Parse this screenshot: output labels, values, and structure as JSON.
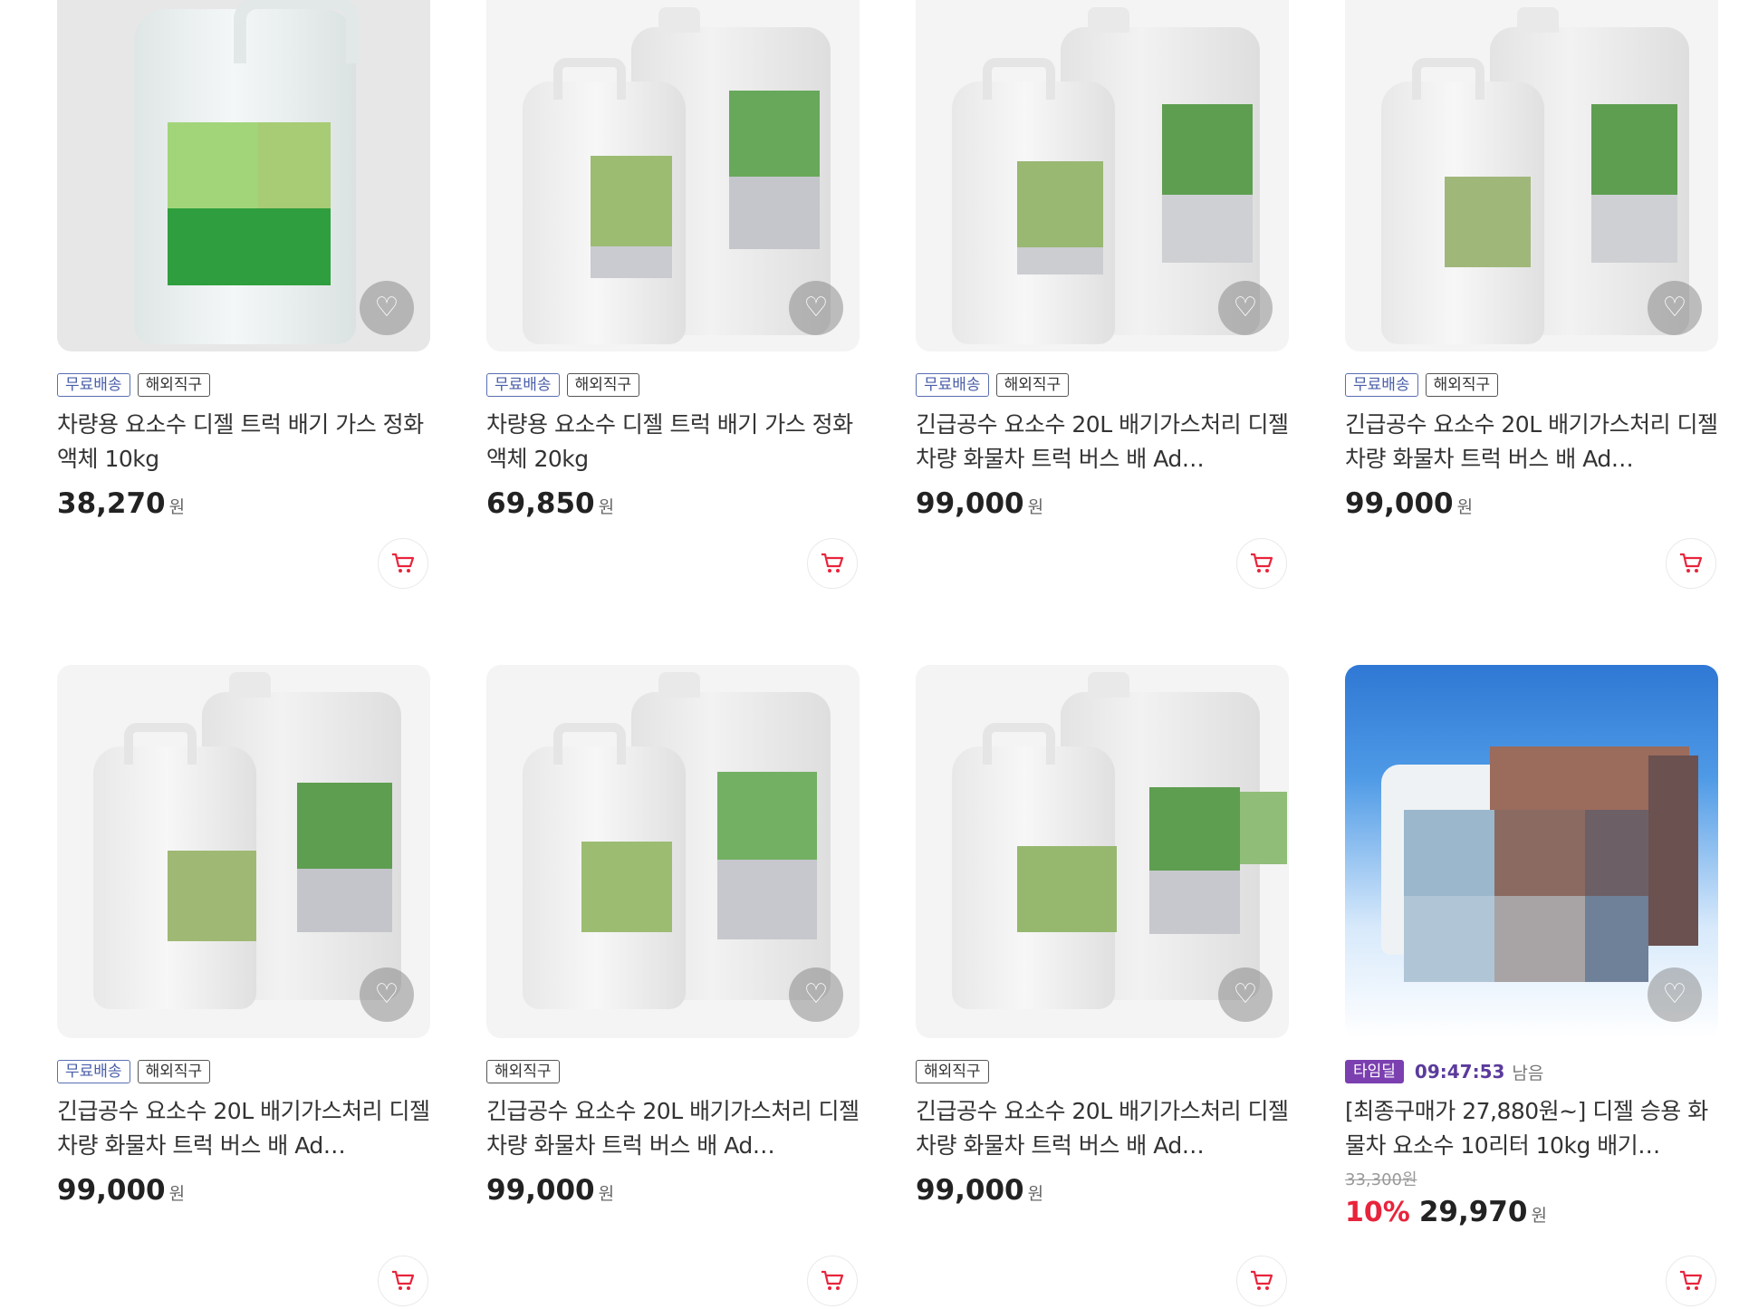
{
  "products": [
    {
      "tags": [
        "무료배송",
        "해외직구"
      ],
      "title": "차량용 요소수 디젤 트럭 배기 가스 정화 액체 10kg",
      "price": "38,270",
      "won": "원"
    },
    {
      "tags": [
        "무료배송",
        "해외직구"
      ],
      "title": "차량용 요소수 디젤 트럭 배기 가스 정화 액체 20kg",
      "price": "69,850",
      "won": "원"
    },
    {
      "tags": [
        "무료배송",
        "해외직구"
      ],
      "title": "긴급공수 요소수 20L 배기가스처리 디젤차량 화물차 트럭 버스 배 Ad…",
      "price": "99,000",
      "won": "원"
    },
    {
      "tags": [
        "무료배송",
        "해외직구"
      ],
      "title": "긴급공수 요소수 20L 배기가스처리 디젤차량 화물차 트럭 버스 배 Ad…",
      "price": "99,000",
      "won": "원"
    },
    {
      "tags": [
        "무료배송",
        "해외직구"
      ],
      "title": "긴급공수 요소수 20L 배기가스처리 디젤차량 화물차 트럭 버스 배 Ad…",
      "price": "99,000",
      "won": "원"
    },
    {
      "tags": [
        "해외직구"
      ],
      "title": "긴급공수 요소수 20L 배기가스처리 디젤차량 화물차 트럭 버스 배 Ad…",
      "price": "99,000",
      "won": "원"
    },
    {
      "tags": [
        "해외직구"
      ],
      "title": "긴급공수 요소수 20L 배기가스처리 디젤차량 화물차 트럭 버스 배 Ad…",
      "price": "99,000",
      "won": "원"
    },
    {
      "timedeal_tag": "타임딜",
      "timer": "09:47:53",
      "timer_suffix": "남음",
      "title": "[최종구매가 27,880원~] 디젤 승용 화물차 요소수 10리터 10kg 배기…",
      "original_price": "33,300원",
      "discount": "10%",
      "price": "29,970",
      "won": "원"
    }
  ],
  "colors": {
    "accent": "#e8243c",
    "timedeal": "#7b3fb0",
    "free_shipping": "#4a5ea8"
  },
  "icons": {
    "wishlist": "heart-icon",
    "cart": "cart-icon"
  }
}
